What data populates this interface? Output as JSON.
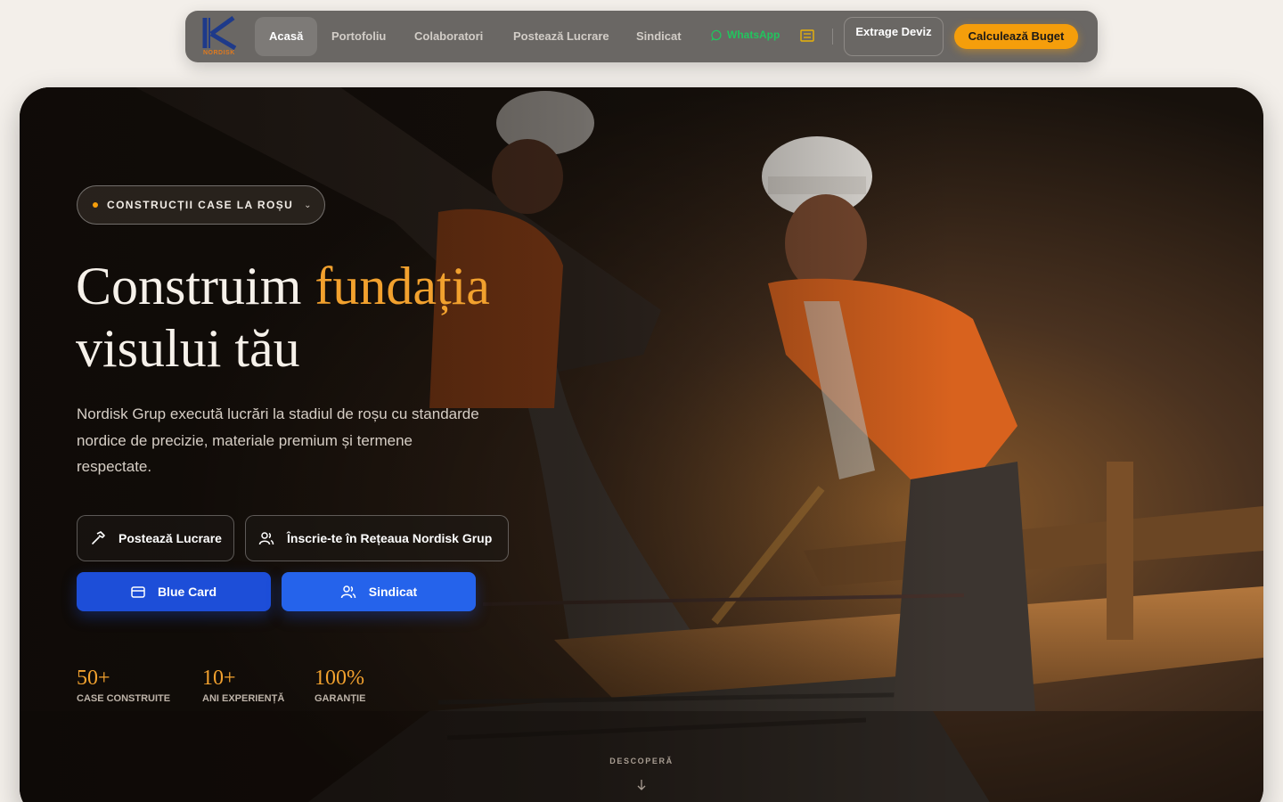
{
  "brand": {
    "logo_text": "NORDISK",
    "logo_letter": "K"
  },
  "nav": {
    "links": [
      "Acasă",
      "Portofoliu",
      "Colaboratori",
      "Postează Lucrare",
      "Sindicat"
    ],
    "whatsapp": "WhatsApp",
    "deviz": "Extrage Deviz",
    "budget": "Calculează Buget"
  },
  "hero": {
    "badge": "CONSTRUCȚII CASE LA ROȘU",
    "headline_pre": "Construim ",
    "headline_accent": "fundația",
    "headline_post": "visului tău",
    "lead": "Nordisk Grup execută lucrări la stadiul de roșu cu standarde nordice de precizie, materiale premium și termene respectate.",
    "buttons": {
      "post": "Postează Lucrare",
      "join": "Înscrie-te în Rețeaua Nordisk Grup",
      "bluecard": "Blue Card",
      "sindicat": "Sindicat"
    },
    "stats": [
      {
        "value": "50+",
        "label": "CASE CONSTRUITE"
      },
      {
        "value": "10+",
        "label": "ANI EXPERIENȚĂ"
      },
      {
        "value": "100%",
        "label": "GARANȚIE"
      }
    ],
    "discover": "DESCOPERĂ"
  },
  "colors": {
    "accent": "#f59e0b",
    "blue": "#1d4ed8",
    "whatsapp": "#22c55e"
  },
  "icons": [
    "whatsapp-icon",
    "menu-icon",
    "chevron-down-icon",
    "hammer-icon",
    "users-icon",
    "card-icon",
    "arrow-down-icon"
  ]
}
